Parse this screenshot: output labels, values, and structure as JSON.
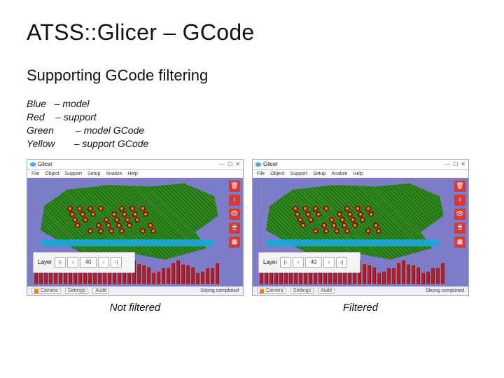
{
  "title": "ATSS::Glicer – GCode",
  "subtitle": "Supporting GCode filtering",
  "legend": [
    {
      "color": "Blue",
      "pad": "   ",
      "meaning": "– model"
    },
    {
      "color": "Red",
      "pad": "    ",
      "meaning": "– support"
    },
    {
      "color": "Green",
      "pad": "        ",
      "meaning": "– model GCode"
    },
    {
      "color": "Yellow",
      "pad": "       ",
      "meaning": "– support GCode"
    }
  ],
  "window": {
    "app_name": "Glicer",
    "menu": [
      "File",
      "Object",
      "Support",
      "Setup",
      "Analize",
      "Help"
    ],
    "right_tool_icons": [
      "trash-icon",
      "info-icon",
      "eye-icon",
      "layers-icon",
      "grid-icon"
    ],
    "layer_panel": {
      "label": "Layer",
      "first": "|‹",
      "prev": "‹",
      "value": "40",
      "next": "›",
      "last": "›|"
    },
    "status": {
      "camera": "Camera",
      "settings": "Settings",
      "audit": "Audit",
      "msg": "Slicing completed"
    },
    "win_controls": {
      "min": "—",
      "max": "☐",
      "close": "✕"
    }
  },
  "captions": {
    "left": "Not filtered",
    "right": "Filtered"
  }
}
